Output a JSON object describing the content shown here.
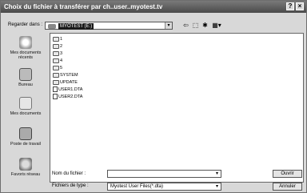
{
  "window": {
    "title": "Choix du fichier à transférer par ch..user..myotest.tv",
    "help_glyph": "?",
    "close_glyph": "×"
  },
  "lookin": {
    "label": "Regarder dans :",
    "value": "MYOTEST (E:)",
    "arrow": "▾"
  },
  "toolbar": {
    "back_glyph": "⇦",
    "up_glyph": "⬚",
    "newfolder_glyph": "✱",
    "views_glyph": "▦▾"
  },
  "places": [
    {
      "label": "Mes documents récents",
      "icon": "recent-docs-icon"
    },
    {
      "label": "Bureau",
      "icon": "desktop-icon"
    },
    {
      "label": "Mes documents",
      "icon": "my-documents-icon"
    },
    {
      "label": "Poste de travail",
      "icon": "computer-icon"
    },
    {
      "label": "Favoris réseau",
      "icon": "network-icon"
    }
  ],
  "files": [
    {
      "name": "1",
      "type": "folder"
    },
    {
      "name": "2",
      "type": "folder"
    },
    {
      "name": "3",
      "type": "folder"
    },
    {
      "name": "4",
      "type": "folder"
    },
    {
      "name": "5",
      "type": "folder"
    },
    {
      "name": "SYSTEM",
      "type": "folder"
    },
    {
      "name": "UPDATE",
      "type": "folder"
    },
    {
      "name": "USER1.DTA",
      "type": "file"
    },
    {
      "name": "USER2.DTA",
      "type": "file"
    }
  ],
  "filename": {
    "label": "Nom du fichier :",
    "value": ""
  },
  "filetype": {
    "label": "Fichiers de type :",
    "value": "Myotest User Files(*.dta)"
  },
  "buttons": {
    "open": "Ouvrir",
    "cancel": "Annuler"
  }
}
